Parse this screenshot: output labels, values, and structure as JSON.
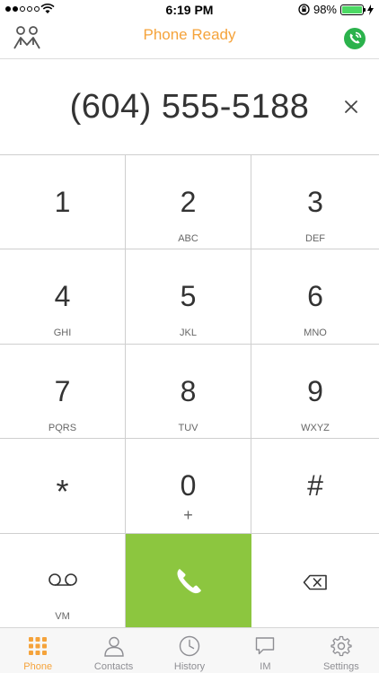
{
  "status_bar": {
    "time": "6:19 PM",
    "battery_text": "98%",
    "battery_level": 0.98,
    "signal_bars_filled": 2,
    "signal_bars_total": 5
  },
  "nav": {
    "title": "Phone Ready",
    "left_icon": "users-icon",
    "right_icon": "phone-status-icon"
  },
  "dialer": {
    "number": "(604) 555-5188"
  },
  "keypad": {
    "keys": [
      {
        "digit": "1",
        "letters": ""
      },
      {
        "digit": "2",
        "letters": "ABC"
      },
      {
        "digit": "3",
        "letters": "DEF"
      },
      {
        "digit": "4",
        "letters": "GHI"
      },
      {
        "digit": "5",
        "letters": "JKL"
      },
      {
        "digit": "6",
        "letters": "MNO"
      },
      {
        "digit": "7",
        "letters": "PQRS"
      },
      {
        "digit": "8",
        "letters": "TUV"
      },
      {
        "digit": "9",
        "letters": "WXYZ"
      },
      {
        "digit": "*",
        "letters": ""
      },
      {
        "digit": "0",
        "letters": "+"
      },
      {
        "digit": "#",
        "letters": ""
      }
    ],
    "voicemail_label": "VM"
  },
  "tabs": [
    {
      "label": "Phone",
      "icon": "keypad-icon",
      "active": true
    },
    {
      "label": "Contacts",
      "icon": "contact-icon",
      "active": false
    },
    {
      "label": "History",
      "icon": "clock-icon",
      "active": false
    },
    {
      "label": "IM",
      "icon": "chat-bubble-icon",
      "active": false
    },
    {
      "label": "Settings",
      "icon": "gear-icon",
      "active": false
    }
  ],
  "colors": {
    "accent": "#f5a33b",
    "call_green": "#8cc63f",
    "status_green": "#2bb24c"
  }
}
